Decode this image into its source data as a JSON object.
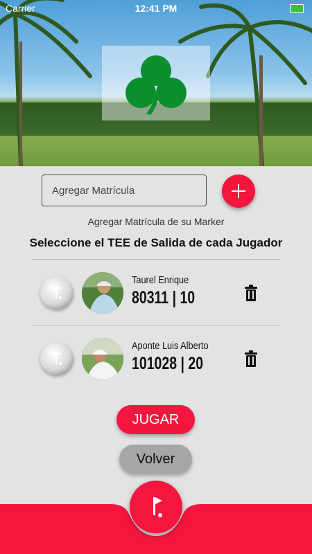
{
  "status_bar": {
    "carrier": "Carrier",
    "time": "12:41 PM"
  },
  "matricula": {
    "placeholder": "Agregar Matrícula",
    "add_icon": "plus-icon"
  },
  "helper_text": "Agregar Matrícula de su Marker",
  "section_title": "Seleccione el TEE de Salida de cada Jugador",
  "players": [
    {
      "name": "Taurel Enrique",
      "info": "80311 | 10"
    },
    {
      "name": "Aponte Luis Alberto",
      "info": "101028 | 20"
    }
  ],
  "buttons": {
    "play": "JUGAR",
    "back": "Volver"
  },
  "colors": {
    "accent": "#f5163f",
    "logo_green": "#0a8f2e"
  }
}
